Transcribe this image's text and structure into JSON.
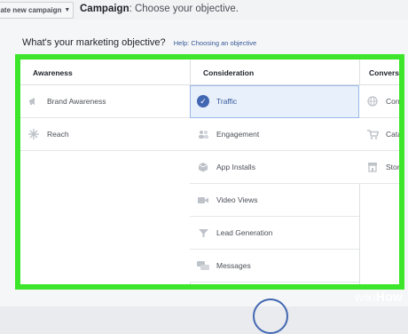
{
  "topbar": {
    "create_button_label": "eate new campaign",
    "campaign_label": "Campaign",
    "campaign_text": ": Choose your objective."
  },
  "objective": {
    "heading": "What's your marketing objective?",
    "help_link": "Help: Choosing an objective"
  },
  "columns": {
    "awareness": {
      "title": "Awareness",
      "items": [
        {
          "label": "Brand Awareness",
          "icon": "megaphone-icon"
        },
        {
          "label": "Reach",
          "icon": "burst-icon"
        }
      ]
    },
    "consideration": {
      "title": "Consideration",
      "items": [
        {
          "label": "Traffic",
          "icon": "check-circle-icon",
          "selected": true
        },
        {
          "label": "Engagement",
          "icon": "people-icon"
        },
        {
          "label": "App Installs",
          "icon": "box-icon"
        },
        {
          "label": "Video Views",
          "icon": "video-camera-icon"
        },
        {
          "label": "Lead Generation",
          "icon": "funnel-icon"
        },
        {
          "label": "Messages",
          "icon": "chat-bubbles-icon"
        }
      ]
    },
    "conversion": {
      "title": "Conversi",
      "items": [
        {
          "label": "Conve",
          "icon": "globe-icon"
        },
        {
          "label": "Catalo",
          "icon": "cart-icon"
        },
        {
          "label": "Store",
          "icon": "store-icon"
        }
      ]
    }
  },
  "watermark": {
    "wiki": "wiki",
    "how": "How"
  },
  "colors": {
    "highlight_frame": "#3ee62b",
    "selected_bg": "#e8f0fc",
    "accent": "#4267b2",
    "link": "#365899"
  }
}
